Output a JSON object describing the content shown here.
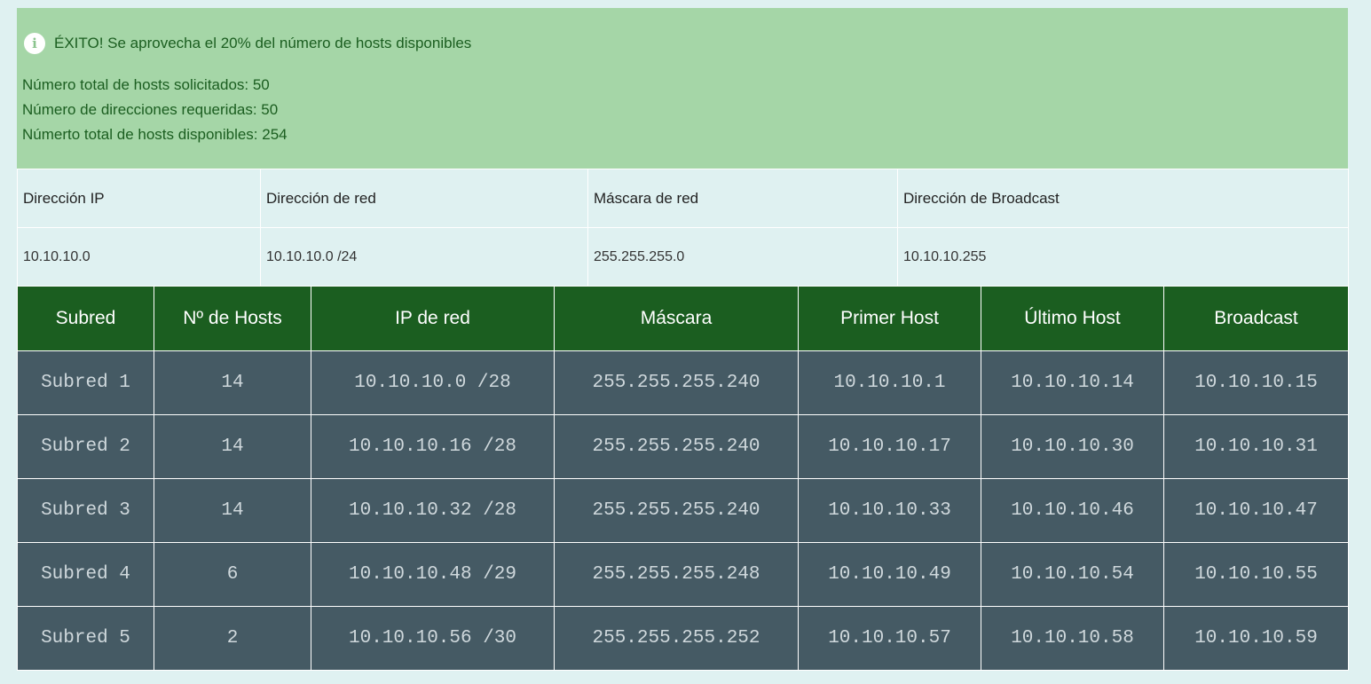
{
  "alert": {
    "icon": "info-icon",
    "title": "ÉXITO! Se aprovecha el 20% del número de hosts disponibles",
    "lines": [
      "Número total de hosts solicitados: 50",
      "Número de direcciones requeridas: 50",
      "Númerto total de hosts disponibles: 254"
    ],
    "colors": {
      "background": "#a5d6a7",
      "text": "#1b5e20"
    }
  },
  "summary": {
    "headers": [
      "Dirección IP",
      "Dirección de red",
      "Máscara de red",
      "Dirección de Broadcast"
    ],
    "values": [
      "10.10.10.0",
      "10.10.10.0 /24",
      "255.255.255.0",
      "10.10.10.255"
    ]
  },
  "subnets": {
    "headers": [
      "Subred",
      "Nº de Hosts",
      "IP de red",
      "Máscara",
      "Primer Host",
      "Último Host",
      "Broadcast"
    ],
    "rows": [
      [
        "Subred 1",
        "14",
        "10.10.10.0 /28",
        "255.255.255.240",
        "10.10.10.1",
        "10.10.10.14",
        "10.10.10.15"
      ],
      [
        "Subred 2",
        "14",
        "10.10.10.16 /28",
        "255.255.255.240",
        "10.10.10.17",
        "10.10.10.30",
        "10.10.10.31"
      ],
      [
        "Subred 3",
        "14",
        "10.10.10.32 /28",
        "255.255.255.240",
        "10.10.10.33",
        "10.10.10.46",
        "10.10.10.47"
      ],
      [
        "Subred 4",
        "6",
        "10.10.10.48 /29",
        "255.255.255.248",
        "10.10.10.49",
        "10.10.10.54",
        "10.10.10.55"
      ],
      [
        "Subred 5",
        "2",
        "10.10.10.56 /30",
        "255.255.255.252",
        "10.10.10.57",
        "10.10.10.58",
        "10.10.10.59"
      ]
    ],
    "colors": {
      "header_bg": "#1b5e20",
      "row_bg": "#455a64",
      "row_text": "#cfd8dc"
    }
  }
}
